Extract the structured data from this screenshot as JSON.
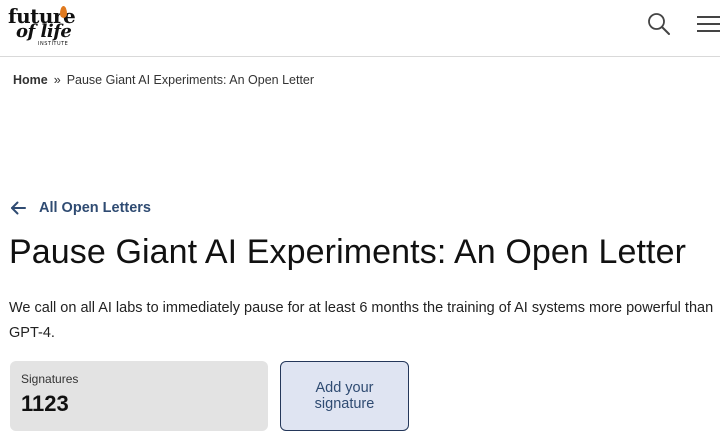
{
  "header": {
    "logo": {
      "line1": "future",
      "line2": "of life",
      "line3": "INSTITUTE"
    },
    "search_icon": "search-icon",
    "menu_icon": "hamburger-menu-icon"
  },
  "breadcrumb": {
    "home": "Home",
    "separator": "»",
    "current": "Pause Giant AI Experiments: An Open Letter"
  },
  "back_link": {
    "label": "All Open Letters",
    "icon": "arrow-left-icon"
  },
  "page": {
    "title": "Pause Giant AI Experiments: An Open Letter",
    "description": "We call on all AI labs to immediately pause for at least 6 months the training of AI systems more powerful than GPT-4."
  },
  "signatures": {
    "label": "Signatures",
    "count": "1123"
  },
  "add_signature_button": {
    "label": "Add your signature"
  },
  "colors": {
    "accent": "#2f4b72",
    "button_bg": "#dfe4f2",
    "card_bg": "#e3e3e3",
    "logo_flame": "#e07a1f"
  }
}
